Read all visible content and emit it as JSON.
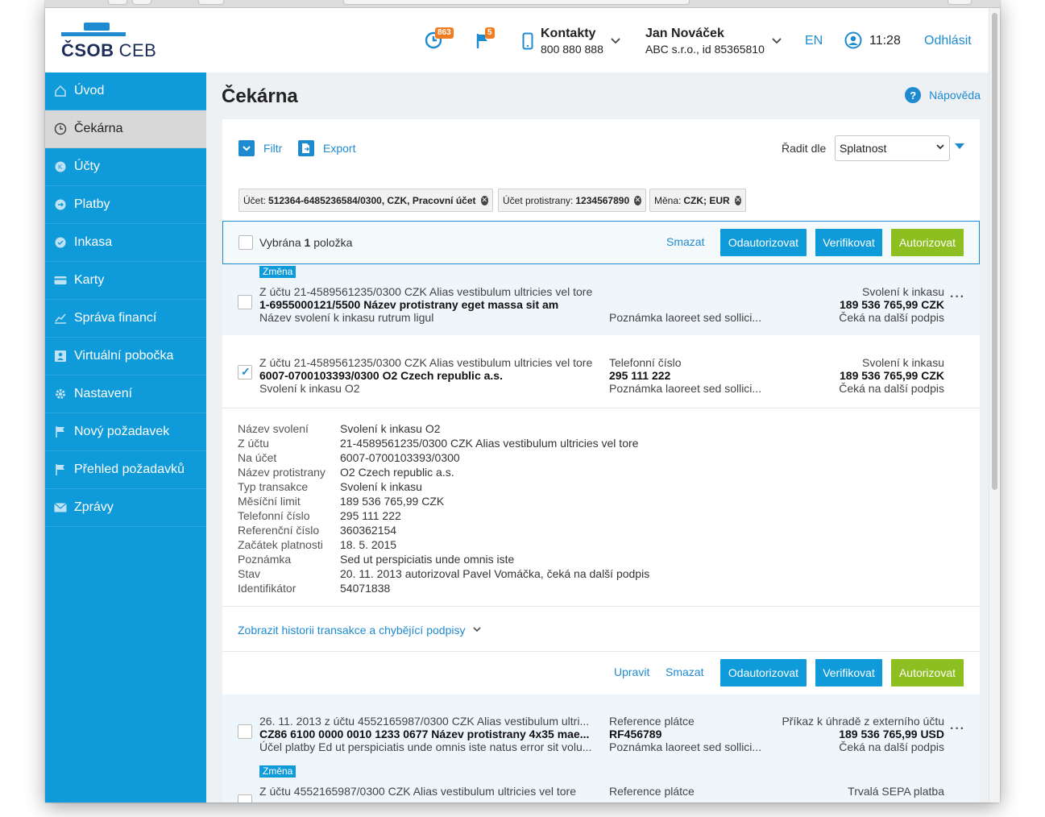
{
  "header": {
    "logo_text": "ČSOB",
    "logo_suffix": "CEB",
    "clock_badge": "863",
    "flag_badge": "5",
    "contacts_title": "Kontakty",
    "contacts_phone": "800 880 888",
    "user_name": "Jan Nováček",
    "user_company": "ABC s.r.o., id 85365810",
    "language": "EN",
    "session_time": "11:28",
    "logout": "Odhlásit"
  },
  "sidebar": {
    "items": [
      {
        "label": "Úvod",
        "icon": "home-icon"
      },
      {
        "label": "Čekárna",
        "icon": "clock-icon"
      },
      {
        "label": "Účty",
        "icon": "accounts-icon"
      },
      {
        "label": "Platby",
        "icon": "payments-icon"
      },
      {
        "label": "Inkasa",
        "icon": "collections-icon"
      },
      {
        "label": "Karty",
        "icon": "card-icon"
      },
      {
        "label": "Správa financí",
        "icon": "chart-icon"
      },
      {
        "label": "Virtuální pobočka",
        "icon": "branch-icon"
      },
      {
        "label": "Nastavení",
        "icon": "gear-icon"
      },
      {
        "label": "Nový požadavek",
        "icon": "flag-icon"
      },
      {
        "label": "Přehled požadavků",
        "icon": "flag-list-icon"
      },
      {
        "label": "Zprávy",
        "icon": "envelope-icon"
      }
    ]
  },
  "main": {
    "title": "Čekárna",
    "help": "Nápověda",
    "toolbar": {
      "filter": "Filtr",
      "export": "Export",
      "sort_label": "Řadit dle",
      "sort_value": "Splatnost"
    },
    "chips": [
      {
        "key": "Účet:",
        "value": "512364-6485236584/0300, CZK, Pracovní účet"
      },
      {
        "key": "Účet protistrany:",
        "value": "1234567890"
      },
      {
        "key": "Měna:",
        "value": "CZK; EUR"
      }
    ],
    "selection": {
      "prefix": "Vybrána",
      "count": "1",
      "suffix": "položka",
      "delete": "Smazat",
      "unauthorize": "Odautorizovat",
      "verify": "Verifikovat",
      "authorize": "Autorizovat"
    },
    "rows": [
      {
        "tag": "Změna",
        "line1": "Z účtu 21-4589561235/0300 CZK Alias vestibulum ultricies vel tore",
        "line2": "1-6955000121/5500 Název protistrany eget massa sit am",
        "line3": "Název svolení k inkasu rutrum ligul",
        "mid1": "",
        "mid2": "",
        "mid3": "Poznámka laoreet sed sollici...",
        "right1": "Svolení k inkasu",
        "right2": "189 536 765,99 CZK",
        "right3": "Čeká na další podpis",
        "checked": false
      },
      {
        "tag": "",
        "line1": "Z účtu 21-4589561235/0300 CZK Alias vestibulum ultricies vel tore",
        "line2": "6007-0700103393/0300 O2 Czech republic a.s.",
        "line3": "Svolení k inkasu O2",
        "mid1": "Telefonní číslo",
        "mid2": "295 111 222",
        "mid3": "Poznámka laoreet sed sollici...",
        "right1": "Svolení k inkasu",
        "right2": "189 536 765,99 CZK",
        "right3": "Čeká na další podpis",
        "checked": true
      },
      {
        "tag": "",
        "line1": "26. 11. 2013 z účtu 4552165987/0300 CZK Alias vestibulum ultri...",
        "line2": "CZ86 6100 0000 0010 1233 0677 Název protistrany 4x35 mae...",
        "line3": "Účel platby Ed ut perspiciatis unde omnis iste natus error sit volu...",
        "mid1": "Reference plátce",
        "mid2": "RF456789",
        "mid3": "Poznámka laoreet sed sollici...",
        "right1": "Příkaz k úhradě z externího účtu",
        "right2": "189 536 765,99 USD",
        "right3": "Čeká na další podpis",
        "checked": false
      },
      {
        "tag": "Změna",
        "line1": "Z účtu 4552165987/0300 CZK Alias vestibulum ultricies vel tore",
        "line2": "",
        "line3": "",
        "mid1": "Reference plátce",
        "mid2": "",
        "mid3": "",
        "right1": "Trvalá SEPA platba",
        "right2": "",
        "right3": "",
        "checked": false
      }
    ],
    "details": [
      {
        "k": "Název svolení",
        "v": "Svolení k inkasu O2"
      },
      {
        "k": "Z účtu",
        "v": "21-4589561235/0300 CZK Alias vestibulum ultricies vel tore"
      },
      {
        "k": "Na účet",
        "v": "6007-0700103393/0300"
      },
      {
        "k": "Název protistrany",
        "v": "O2 Czech republic a.s."
      },
      {
        "k": "Typ transakce",
        "v": "Svolení k inkasu"
      },
      {
        "k": "Měsíční limit",
        "v": "189 536 765,99 CZK"
      },
      {
        "k": "Telefonní číslo",
        "v": "295 111 222"
      },
      {
        "k": "Referenční číslo",
        "v": "360362154"
      },
      {
        "k": "Začátek platnosti",
        "v": "18. 5. 2015"
      },
      {
        "k": "Poznámka",
        "v": "Sed ut perspiciatis unde omnis iste"
      },
      {
        "k": "Stav",
        "v": "20. 11. 2013 autorizoval Pavel Vomáčka, čeká na další podpis"
      },
      {
        "k": "Identifikátor",
        "v": "54071838"
      }
    ],
    "history_link": "Zobrazit historii transakce a chybějící podpisy",
    "detail_actions": {
      "edit": "Upravit",
      "delete": "Smazat",
      "unauthorize": "Odautorizovat",
      "verify": "Verifikovat",
      "authorize": "Autorizovat"
    }
  }
}
